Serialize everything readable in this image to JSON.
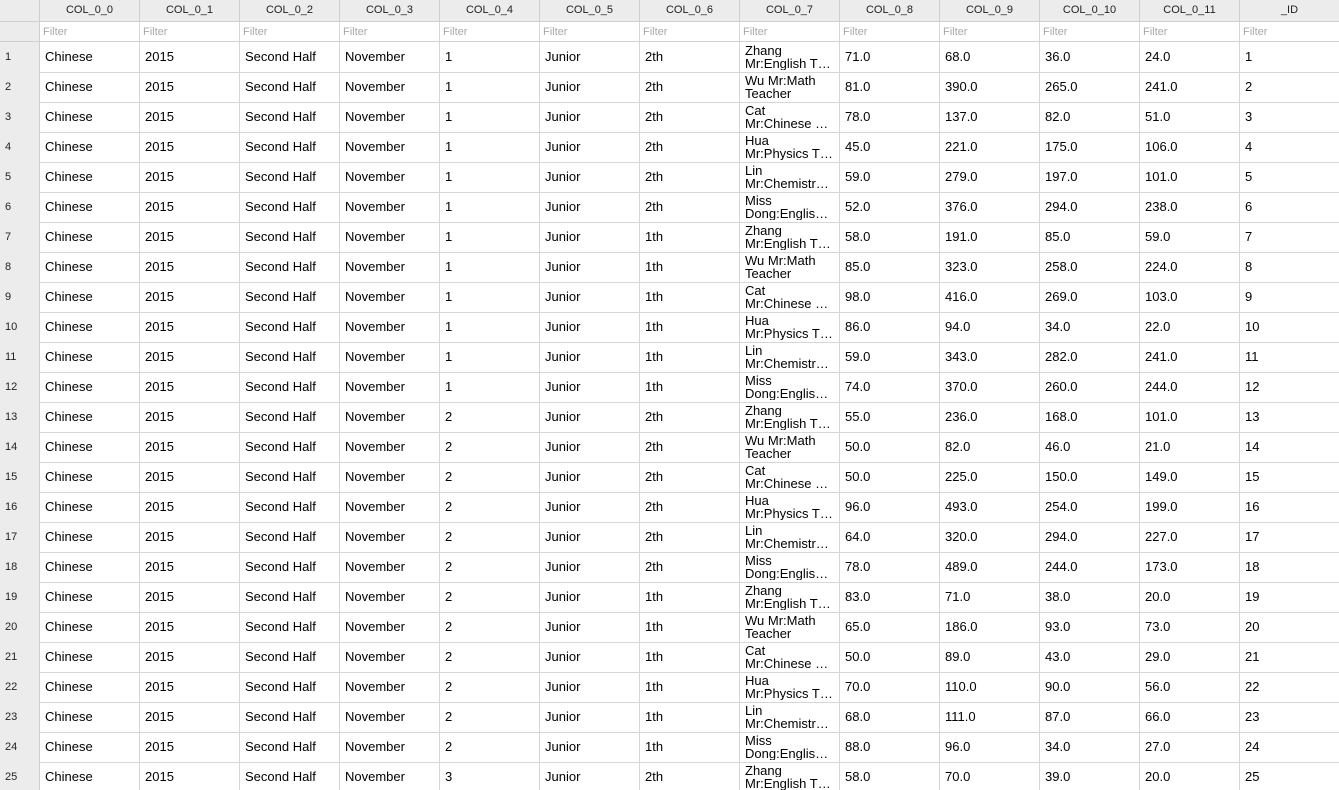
{
  "columns": [
    "COL_0_0",
    "COL_0_1",
    "COL_0_2",
    "COL_0_3",
    "COL_0_4",
    "COL_0_5",
    "COL_0_6",
    "COL_0_7",
    "COL_0_8",
    "COL_0_9",
    "COL_0_10",
    "COL_0_11",
    "_ID"
  ],
  "filter_placeholder": "Filter",
  "rows": [
    {
      "n": "1",
      "c": [
        "Chinese",
        "2015",
        "Second Half",
        "November",
        "1",
        "Junior",
        "2th",
        [
          "Zhang",
          "Mr:English T…"
        ],
        "71.0",
        "68.0",
        "36.0",
        "24.0",
        "1"
      ]
    },
    {
      "n": "2",
      "c": [
        "Chinese",
        "2015",
        "Second Half",
        "November",
        "1",
        "Junior",
        "2th",
        [
          "Wu Mr:Math",
          "Teacher"
        ],
        "81.0",
        "390.0",
        "265.0",
        "241.0",
        "2"
      ]
    },
    {
      "n": "3",
      "c": [
        "Chinese",
        "2015",
        "Second Half",
        "November",
        "1",
        "Junior",
        "2th",
        [
          "Cat",
          "Mr:Chinese …"
        ],
        "78.0",
        "137.0",
        "82.0",
        "51.0",
        "3"
      ]
    },
    {
      "n": "4",
      "c": [
        "Chinese",
        "2015",
        "Second Half",
        "November",
        "1",
        "Junior",
        "2th",
        [
          "Hua",
          "Mr:Physics T…"
        ],
        "45.0",
        "221.0",
        "175.0",
        "106.0",
        "4"
      ]
    },
    {
      "n": "5",
      "c": [
        "Chinese",
        "2015",
        "Second Half",
        "November",
        "1",
        "Junior",
        "2th",
        [
          "Lin",
          "Mr:Chemistr…"
        ],
        "59.0",
        "279.0",
        "197.0",
        "101.0",
        "5"
      ]
    },
    {
      "n": "6",
      "c": [
        "Chinese",
        "2015",
        "Second Half",
        "November",
        "1",
        "Junior",
        "2th",
        [
          "Miss",
          "Dong:Englis…"
        ],
        "52.0",
        "376.0",
        "294.0",
        "238.0",
        "6"
      ]
    },
    {
      "n": "7",
      "c": [
        "Chinese",
        "2015",
        "Second Half",
        "November",
        "1",
        "Junior",
        "1th",
        [
          "Zhang",
          "Mr:English T…"
        ],
        "58.0",
        "191.0",
        "85.0",
        "59.0",
        "7"
      ]
    },
    {
      "n": "8",
      "c": [
        "Chinese",
        "2015",
        "Second Half",
        "November",
        "1",
        "Junior",
        "1th",
        [
          "Wu Mr:Math",
          "Teacher"
        ],
        "85.0",
        "323.0",
        "258.0",
        "224.0",
        "8"
      ]
    },
    {
      "n": "9",
      "c": [
        "Chinese",
        "2015",
        "Second Half",
        "November",
        "1",
        "Junior",
        "1th",
        [
          "Cat",
          "Mr:Chinese …"
        ],
        "98.0",
        "416.0",
        "269.0",
        "103.0",
        "9"
      ]
    },
    {
      "n": "10",
      "c": [
        "Chinese",
        "2015",
        "Second Half",
        "November",
        "1",
        "Junior",
        "1th",
        [
          "Hua",
          "Mr:Physics T…"
        ],
        "86.0",
        "94.0",
        "34.0",
        "22.0",
        "10"
      ]
    },
    {
      "n": "11",
      "c": [
        "Chinese",
        "2015",
        "Second Half",
        "November",
        "1",
        "Junior",
        "1th",
        [
          "Lin",
          "Mr:Chemistr…"
        ],
        "59.0",
        "343.0",
        "282.0",
        "241.0",
        "11"
      ]
    },
    {
      "n": "12",
      "c": [
        "Chinese",
        "2015",
        "Second Half",
        "November",
        "1",
        "Junior",
        "1th",
        [
          "Miss",
          "Dong:Englis…"
        ],
        "74.0",
        "370.0",
        "260.0",
        "244.0",
        "12"
      ]
    },
    {
      "n": "13",
      "c": [
        "Chinese",
        "2015",
        "Second Half",
        "November",
        "2",
        "Junior",
        "2th",
        [
          "Zhang",
          "Mr:English T…"
        ],
        "55.0",
        "236.0",
        "168.0",
        "101.0",
        "13"
      ]
    },
    {
      "n": "14",
      "c": [
        "Chinese",
        "2015",
        "Second Half",
        "November",
        "2",
        "Junior",
        "2th",
        [
          "Wu Mr:Math",
          "Teacher"
        ],
        "50.0",
        "82.0",
        "46.0",
        "21.0",
        "14"
      ]
    },
    {
      "n": "15",
      "c": [
        "Chinese",
        "2015",
        "Second Half",
        "November",
        "2",
        "Junior",
        "2th",
        [
          "Cat",
          "Mr:Chinese …"
        ],
        "50.0",
        "225.0",
        "150.0",
        "149.0",
        "15"
      ]
    },
    {
      "n": "16",
      "c": [
        "Chinese",
        "2015",
        "Second Half",
        "November",
        "2",
        "Junior",
        "2th",
        [
          "Hua",
          "Mr:Physics T…"
        ],
        "96.0",
        "493.0",
        "254.0",
        "199.0",
        "16"
      ]
    },
    {
      "n": "17",
      "c": [
        "Chinese",
        "2015",
        "Second Half",
        "November",
        "2",
        "Junior",
        "2th",
        [
          "Lin",
          "Mr:Chemistr…"
        ],
        "64.0",
        "320.0",
        "294.0",
        "227.0",
        "17"
      ]
    },
    {
      "n": "18",
      "c": [
        "Chinese",
        "2015",
        "Second Half",
        "November",
        "2",
        "Junior",
        "2th",
        [
          "Miss",
          "Dong:Englis…"
        ],
        "78.0",
        "489.0",
        "244.0",
        "173.0",
        "18"
      ]
    },
    {
      "n": "19",
      "c": [
        "Chinese",
        "2015",
        "Second Half",
        "November",
        "2",
        "Junior",
        "1th",
        [
          "Zhang",
          "Mr:English T…"
        ],
        "83.0",
        "71.0",
        "38.0",
        "20.0",
        "19"
      ]
    },
    {
      "n": "20",
      "c": [
        "Chinese",
        "2015",
        "Second Half",
        "November",
        "2",
        "Junior",
        "1th",
        [
          "Wu Mr:Math",
          "Teacher"
        ],
        "65.0",
        "186.0",
        "93.0",
        "73.0",
        "20"
      ]
    },
    {
      "n": "21",
      "c": [
        "Chinese",
        "2015",
        "Second Half",
        "November",
        "2",
        "Junior",
        "1th",
        [
          "Cat",
          "Mr:Chinese …"
        ],
        "50.0",
        "89.0",
        "43.0",
        "29.0",
        "21"
      ]
    },
    {
      "n": "22",
      "c": [
        "Chinese",
        "2015",
        "Second Half",
        "November",
        "2",
        "Junior",
        "1th",
        [
          "Hua",
          "Mr:Physics T…"
        ],
        "70.0",
        "110.0",
        "90.0",
        "56.0",
        "22"
      ]
    },
    {
      "n": "23",
      "c": [
        "Chinese",
        "2015",
        "Second Half",
        "November",
        "2",
        "Junior",
        "1th",
        [
          "Lin",
          "Mr:Chemistr…"
        ],
        "68.0",
        "111.0",
        "87.0",
        "66.0",
        "23"
      ]
    },
    {
      "n": "24",
      "c": [
        "Chinese",
        "2015",
        "Second Half",
        "November",
        "2",
        "Junior",
        "1th",
        [
          "Miss",
          "Dong:Englis…"
        ],
        "88.0",
        "96.0",
        "34.0",
        "27.0",
        "24"
      ]
    },
    {
      "n": "25",
      "c": [
        "Chinese",
        "2015",
        "Second Half",
        "November",
        "3",
        "Junior",
        "2th",
        [
          "Zhang",
          "Mr:English T…"
        ],
        "58.0",
        "70.0",
        "39.0",
        "20.0",
        "25"
      ]
    }
  ]
}
